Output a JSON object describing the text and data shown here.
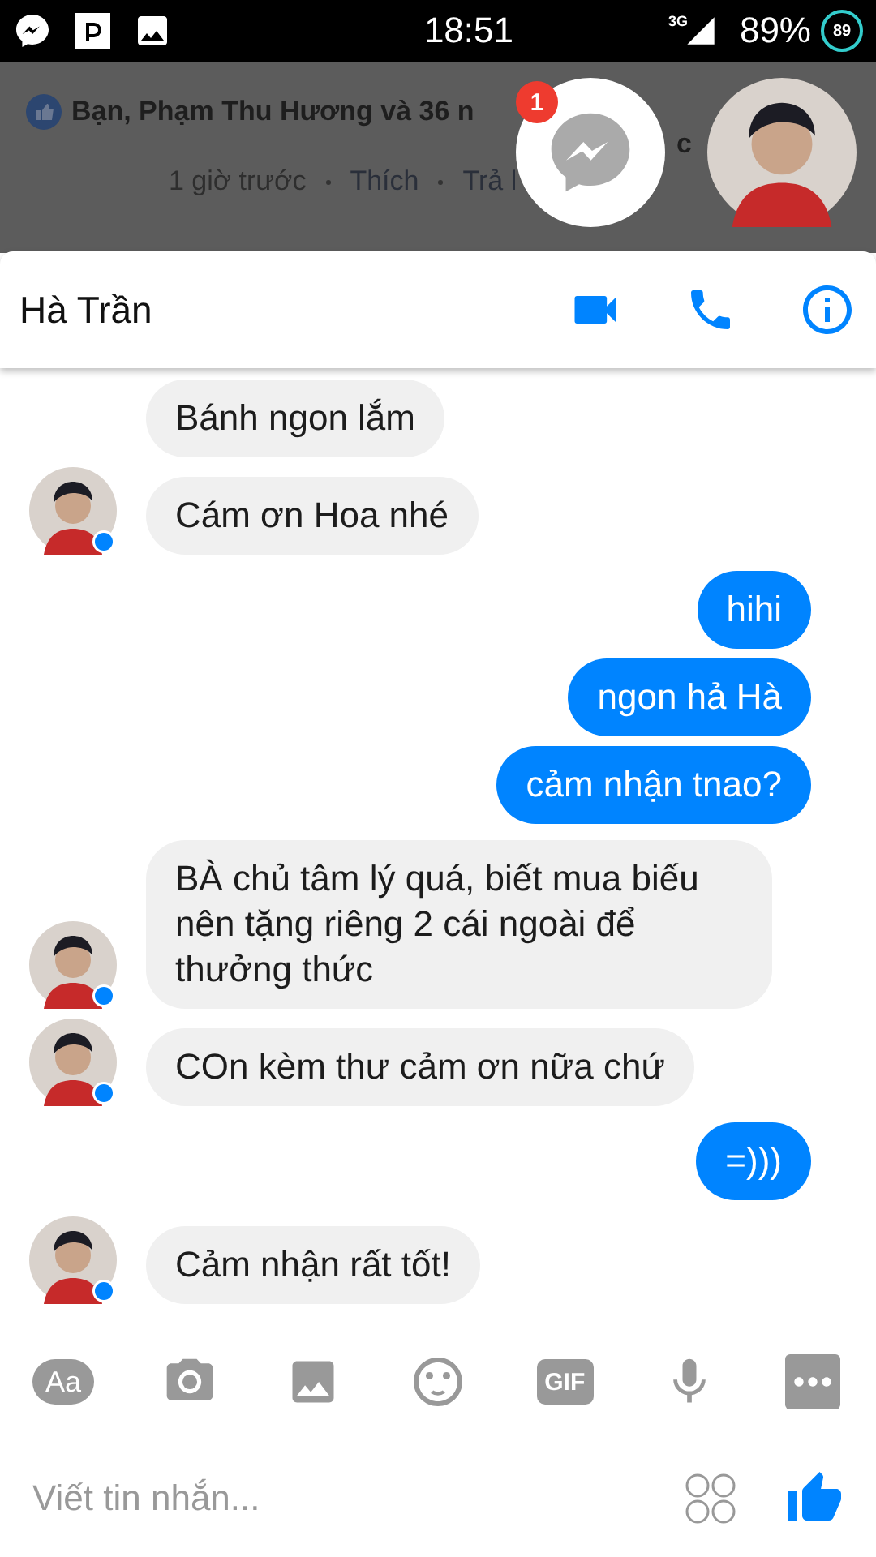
{
  "status_bar": {
    "time": "18:51",
    "network": "3G",
    "battery": "89%",
    "battery_badge": "89"
  },
  "background_post": {
    "liked_by": "Bạn, Phạm Thu Hương và 36 n",
    "liked_by_tail": "c",
    "time": "1 giờ trước",
    "actions": [
      "Thích",
      "Trả l"
    ]
  },
  "chat_heads": [
    {
      "kind": "messenger",
      "badge": "1"
    },
    {
      "kind": "avatar"
    }
  ],
  "header": {
    "name": "Hà Trần"
  },
  "messages": [
    {
      "outgoing": false,
      "avatar": false,
      "text": "Bánh ngon lắm"
    },
    {
      "outgoing": false,
      "avatar": true,
      "text": "Cám ơn Hoa nhé"
    },
    {
      "outgoing": true,
      "avatar": false,
      "text": "hihi"
    },
    {
      "outgoing": true,
      "avatar": false,
      "text": "ngon hả Hà"
    },
    {
      "outgoing": true,
      "avatar": false,
      "text": "cảm nhận tnao?"
    },
    {
      "outgoing": false,
      "avatar": true,
      "text": "BÀ chủ tâm lý quá, biết mua biếu nên tặng riêng 2 cái ngoài để thưởng thức"
    },
    {
      "outgoing": false,
      "avatar": true,
      "text": "COn kèm thư cảm ơn nữa chứ"
    },
    {
      "outgoing": true,
      "avatar": false,
      "text": "=)))"
    },
    {
      "outgoing": false,
      "avatar": true,
      "text": "Cảm nhận rất tốt!"
    }
  ],
  "toolbar": {
    "text_button": "Aa",
    "gif_button": "GIF"
  },
  "composer": {
    "placeholder": "Viết tin nhắn..."
  }
}
